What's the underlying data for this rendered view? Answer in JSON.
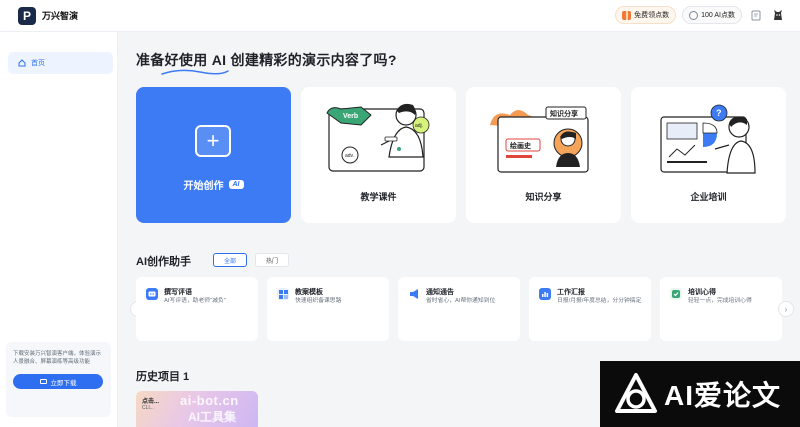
{
  "app": {
    "name": "万兴智演",
    "logo_letter": "P"
  },
  "topbar": {
    "free_points_label": "免费领点数",
    "points_label": "100 AI点数"
  },
  "sidebar": {
    "nav_home": "首页",
    "promo_text": "下载安装万兴智演客户端，体验演示人景融合、屏幕演练等高级功能",
    "download_button": "立即下载"
  },
  "main": {
    "heading_prefix": "准备好使用",
    "heading_ai": "AI",
    "heading_suffix": "创建精彩的演示内容了吗?",
    "cards": [
      {
        "label": "开始创作",
        "tag": "AI"
      },
      {
        "label": "教学课件"
      },
      {
        "label": "知识分享"
      },
      {
        "label": "企业培训"
      }
    ],
    "card_art": {
      "verb": "Verb",
      "adj": "adj.",
      "adv": "adv.",
      "knowledge": "知识分享",
      "history": "绘画史"
    },
    "assistant": {
      "title": "AI创作助手",
      "filters": [
        "全部",
        "热门"
      ],
      "items": [
        {
          "title": "撰写评语",
          "desc": "AI写评语，助老师\"减负\""
        },
        {
          "title": "教案模板",
          "desc": "快速组织备课思路"
        },
        {
          "title": "通知通告",
          "desc": "省时省心，AI帮你通知到位"
        },
        {
          "title": "工作汇报",
          "desc": "日报/月报/年度总结，分分钟搞定"
        },
        {
          "title": "培训心得",
          "desc": "轻轻一点，完成培训心得"
        }
      ]
    },
    "history": {
      "title": "历史项目 1",
      "thumb_title": "点击...",
      "thumb_sub": "CLI..."
    }
  },
  "watermark": {
    "thumb_line1": "ai-bot.cn",
    "thumb_line2": "AI工具集",
    "badge_text": "AI爱论文"
  },
  "colors": {
    "primary": "#3c7bf4",
    "sidebar_active_bg": "#eef4ff",
    "main_bg": "#f4f5f7"
  }
}
